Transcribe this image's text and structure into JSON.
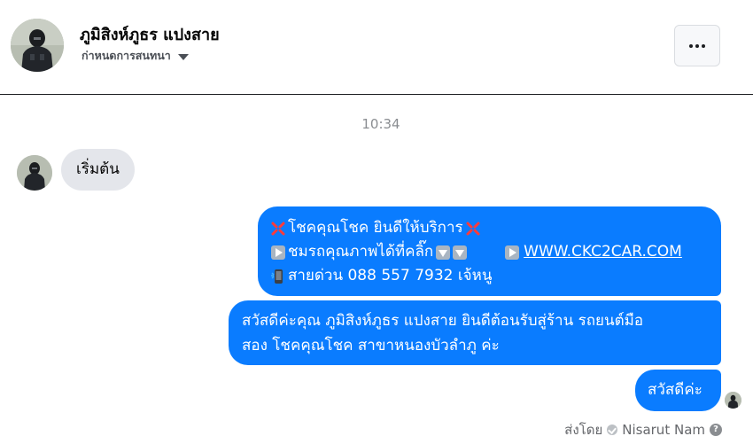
{
  "header": {
    "contact_name": "ภูมิสิงห์ภูธร แปงสาย",
    "manage_label": "ก่าหนดการสนทนา",
    "more_label": "···"
  },
  "thread": {
    "timestamp": "10:34",
    "incoming": [
      {
        "text": "เริ่มต้น"
      }
    ],
    "outgoing": {
      "message1": {
        "line1_text": "โชคคุณโชค ยินดีให้บริการ",
        "line2_text": "ชมรถคุณภาพได้ที่คลิ๊ก",
        "line2_link": "WWW.CKC2CAR.COM",
        "line3_text": "สายด่วน 088 557 7932 เจ้หนู"
      },
      "message2": {
        "line1": "สวัสดีค่ะคุณ ภูมิสิงห์ภูธร แปงสาย ยินดีต้อนรับสู่ร้าน รถยนต์มือ",
        "line2": "สอง โชคคุณโชค สาขาหนองบัวลำภู ค่ะ"
      },
      "message3": {
        "text": "สวัสดีค่ะ"
      }
    },
    "sent_by": {
      "prefix": "ส่งโดย",
      "name": "Nisarut Nam",
      "help": "?"
    }
  },
  "icons": {
    "header_avatar": "user-avatar",
    "more": "ellipsis-icon",
    "caret": "caret-down-icon",
    "anger": "anger-symbol-icon",
    "play": "play-button-icon",
    "down": "down-arrow-icon",
    "phone": "mobile-phone-icon",
    "check": "check-circle-icon",
    "help": "help-icon"
  },
  "colors": {
    "outgoing_bubble": "#0a7cff",
    "incoming_bubble": "#e4e6eb",
    "timestamp": "#8a8d91",
    "secondary_text": "#65676b"
  }
}
